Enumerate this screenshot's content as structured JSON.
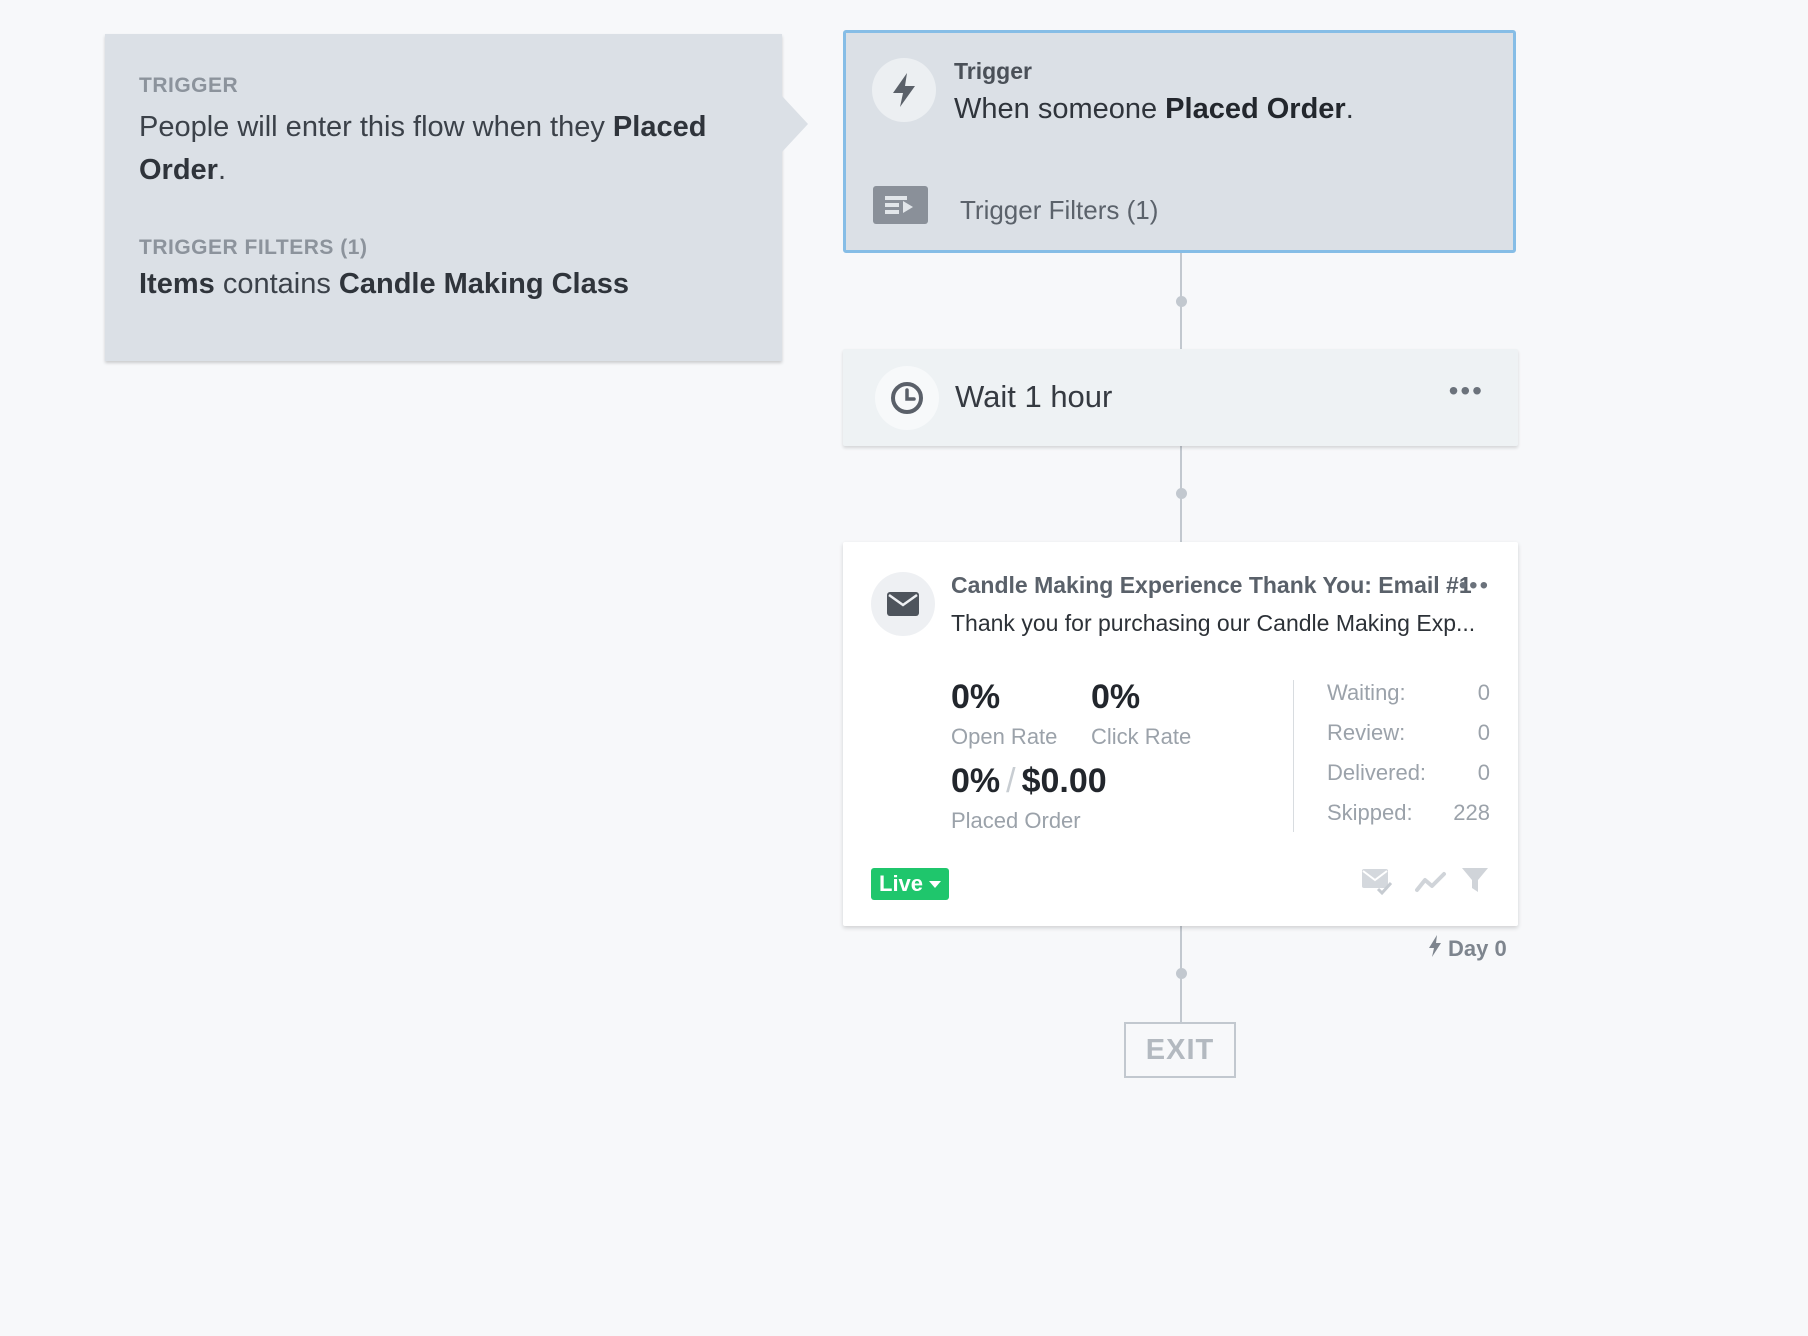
{
  "info_panel": {
    "trigger_label": "TRIGGER",
    "trigger_text_prefix": "People will enter this flow when they ",
    "trigger_event": "Placed Order",
    "trigger_text_suffix": ".",
    "filters_label": "TRIGGER FILTERS (1)",
    "filter_field": "Items",
    "filter_operator": " contains ",
    "filter_value": "Candle Making Class"
  },
  "trigger_card": {
    "title": "Trigger",
    "desc_prefix": "When someone ",
    "desc_event": "Placed Order",
    "desc_suffix": ".",
    "filters_label": "Trigger Filters (1)",
    "icon": "lightning-icon"
  },
  "wait_card": {
    "label": "Wait 1 hour",
    "menu": "•••",
    "icon": "clock-icon"
  },
  "email_card": {
    "title": "Candle Making Experience Thank You: Email #1",
    "menu": "•••",
    "subject": "Thank you for purchasing our Candle Making Exp...",
    "open_rate_value": "0%",
    "open_rate_label": "Open Rate",
    "click_rate_value": "0%",
    "click_rate_label": "Click Rate",
    "placed_order_rate": "0%",
    "placed_order_slash": "/",
    "placed_order_revenue": "$0.00",
    "placed_order_label": "Placed Order",
    "stats": [
      {
        "label": "Waiting:",
        "value": "0"
      },
      {
        "label": "Review:",
        "value": "0"
      },
      {
        "label": "Delivered:",
        "value": "0"
      },
      {
        "label": "Skipped:",
        "value": "228"
      }
    ],
    "status_label": "Live",
    "status_color": "#1fc66c",
    "icon": "envelope-icon"
  },
  "day_label": "Day 0",
  "exit_label": "EXIT",
  "colors": {
    "accent_border": "#86bde6",
    "live_green": "#1fc66c",
    "panel_bg": "#dbe0e6"
  }
}
